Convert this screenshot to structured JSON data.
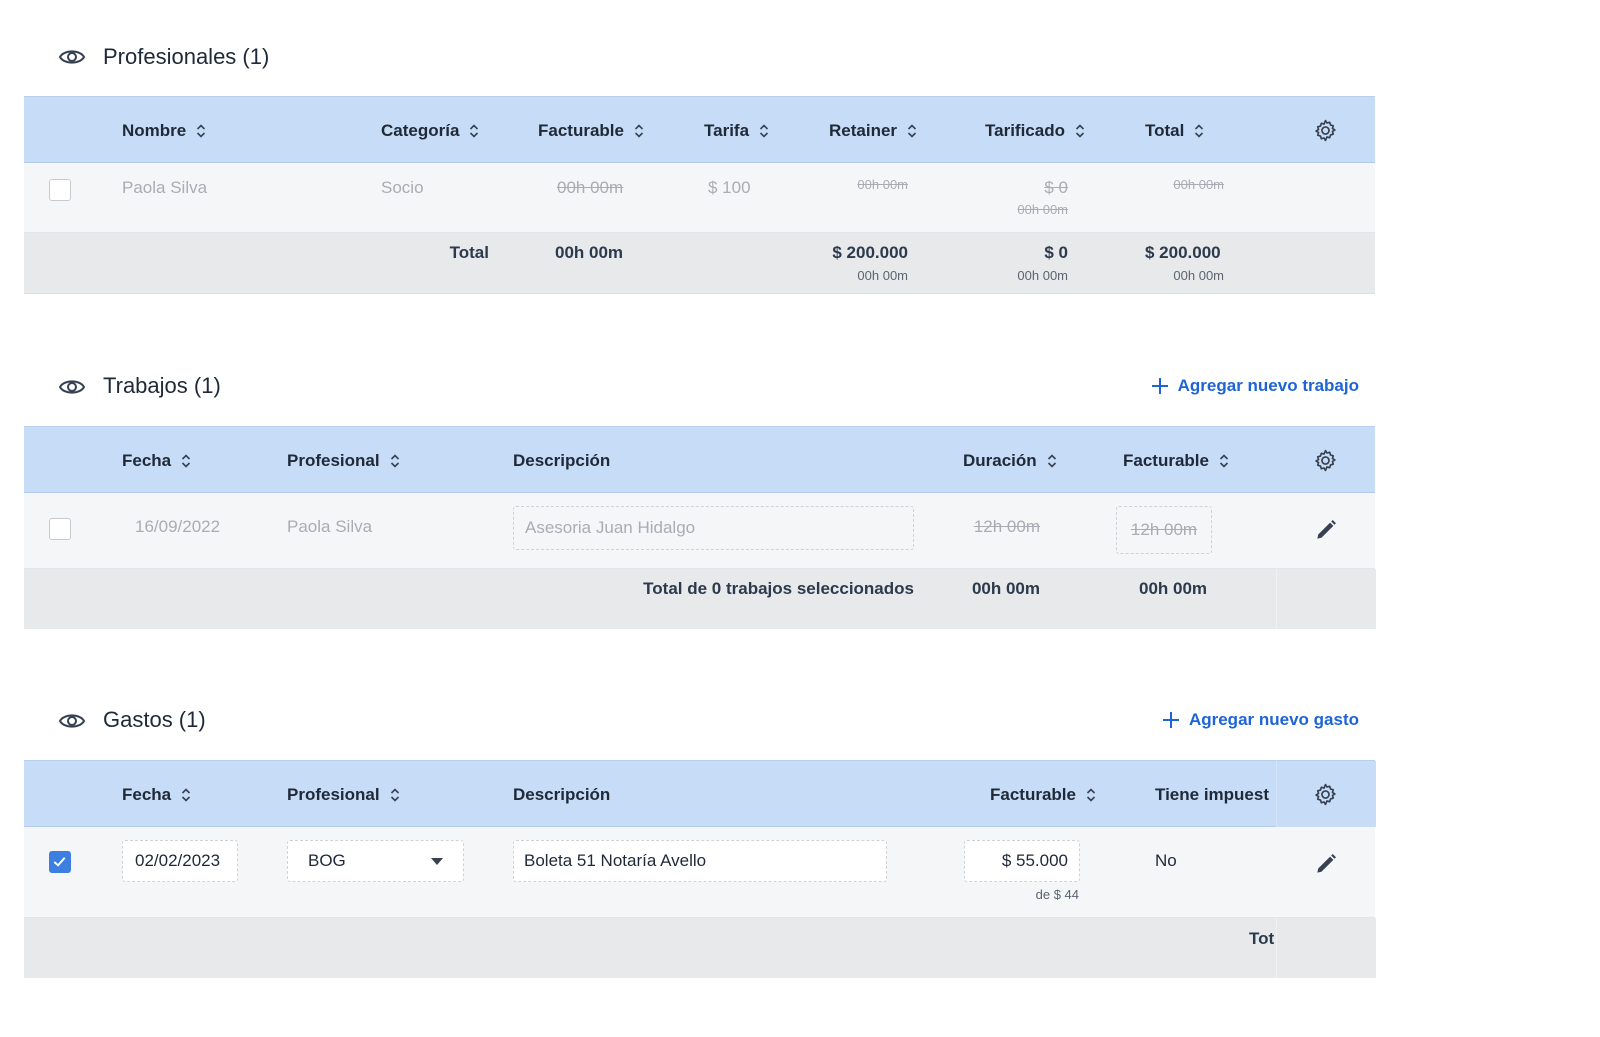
{
  "profesionales": {
    "title": "Profesionales (1)",
    "headers": {
      "nombre": "Nombre",
      "categoria": "Categoría",
      "facturable": "Facturable",
      "tarifa": "Tarifa",
      "retainer": "Retainer",
      "tarificado": "Tarificado",
      "total": "Total"
    },
    "row": {
      "nombre": "Paola Silva",
      "categoria": "Socio",
      "facturable": "00h 00m",
      "tarifa": "$ 100",
      "retainer": "00h 00m",
      "tarificado": "$ 0",
      "tarificado_sub": "00h 00m",
      "total": "00h 00m"
    },
    "footer": {
      "label": "Total",
      "facturable": "00h 00m",
      "retainer": "$ 200.000",
      "retainer_sub": "00h 00m",
      "tarificado": "$ 0",
      "tarificado_sub": "00h 00m",
      "total": "$ 200.000",
      "total_sub": "00h 00m"
    }
  },
  "trabajos": {
    "title": "Trabajos (1)",
    "add_label": "Agregar nuevo trabajo",
    "headers": {
      "fecha": "Fecha",
      "profesional": "Profesional",
      "descripcion": "Descripción",
      "duracion": "Duración",
      "facturable": "Facturable"
    },
    "row": {
      "fecha": "16/09/2022",
      "profesional": "Paola Silva",
      "descripcion": "Asesoria Juan Hidalgo",
      "duracion": "12h 00m",
      "facturable": "12h 00m"
    },
    "footer": {
      "label": "Total de 0 trabajos seleccionados",
      "duracion": "00h 00m",
      "facturable": "00h 00m"
    }
  },
  "gastos": {
    "title": "Gastos (1)",
    "add_label": "Agregar nuevo gasto",
    "headers": {
      "fecha": "Fecha",
      "profesional": "Profesional",
      "descripcion": "Descripción",
      "facturable": "Facturable",
      "impuesto": "Tiene impuest"
    },
    "row": {
      "fecha": "02/02/2023",
      "profesional": "BOG",
      "descripcion": "Boleta 51 Notaría Avello",
      "facturable": "$ 55.000",
      "facturable_sub": "de $ 44",
      "impuesto": "No"
    },
    "footer": {
      "label": "Tot"
    }
  },
  "colors": {
    "header_bg": "#c6dcf7",
    "row_bg": "#f5f6f8",
    "footer_bg": "#e8e9eb",
    "accent": "#1e64d6",
    "checkbox_checked": "#3d7fe0"
  }
}
